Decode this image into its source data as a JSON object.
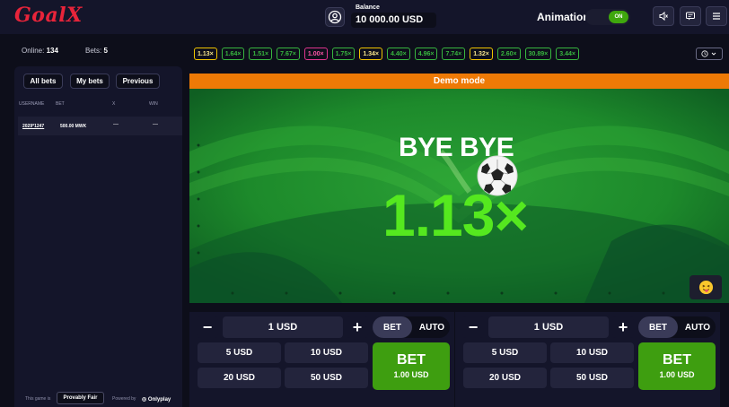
{
  "header": {
    "logo": "GoalX",
    "balance_label": "Balance",
    "balance_value": "10 000.00 USD",
    "animation_label": "Animation",
    "animation_toggle": "ON",
    "icons": [
      "user-icon",
      "sound-icon",
      "chat-icon",
      "menu-icon"
    ]
  },
  "stats": {
    "online_label": "Online:",
    "online_value": "134",
    "bets_label": "Bets:",
    "bets_value": "5"
  },
  "multipliers": [
    {
      "v": "1.13×",
      "c": "gold"
    },
    {
      "v": "1.64×",
      "c": "green"
    },
    {
      "v": "1.51×",
      "c": "green"
    },
    {
      "v": "7.67×",
      "c": "green"
    },
    {
      "v": "1.00×",
      "c": "pink"
    },
    {
      "v": "1.75×",
      "c": "green"
    },
    {
      "v": "1.34×",
      "c": "gold"
    },
    {
      "v": "4.40×",
      "c": "green"
    },
    {
      "v": "4.96×",
      "c": "green"
    },
    {
      "v": "7.74×",
      "c": "green"
    },
    {
      "v": "1.32×",
      "c": "gold"
    },
    {
      "v": "2.60×",
      "c": "green"
    },
    {
      "v": "30.89×",
      "c": "green"
    },
    {
      "v": "3.44×",
      "c": "green"
    }
  ],
  "colors": {
    "green": "#38b63f",
    "gold": "#f0c400",
    "pink": "#e0358f",
    "accent": "#3e9e10",
    "demo": "#ee7a06"
  },
  "sidebar": {
    "tabs": [
      "All bets",
      "My bets",
      "Previous"
    ],
    "columns": [
      "USERNAME",
      "BET",
      "X",
      "WIN"
    ],
    "rows": [
      {
        "user": "2029*1247",
        "bet": "500.00 MWK",
        "x": "—",
        "win": "—"
      }
    ],
    "footer_game_is": "This game is",
    "provably_fair": "Provably Fair",
    "powered_by": "Powered by",
    "provider": "Onlyplay"
  },
  "game": {
    "demo_label": "Demo mode",
    "result_text": "BYE BYE",
    "multiplier": "1.13×",
    "emoji": "😝"
  },
  "bet_panels": [
    {
      "amount": "1 USD",
      "minus": "−",
      "plus": "+",
      "mode_bet": "BET",
      "mode_auto": "AUTO",
      "quick": [
        "5 USD",
        "10 USD",
        "20 USD",
        "50 USD"
      ],
      "button_label": "BET",
      "button_amount": "1.00 USD"
    },
    {
      "amount": "1 USD",
      "minus": "−",
      "plus": "+",
      "mode_bet": "BET",
      "mode_auto": "AUTO",
      "quick": [
        "5 USD",
        "10 USD",
        "20 USD",
        "50 USD"
      ],
      "button_label": "BET",
      "button_amount": "1.00 USD"
    }
  ]
}
